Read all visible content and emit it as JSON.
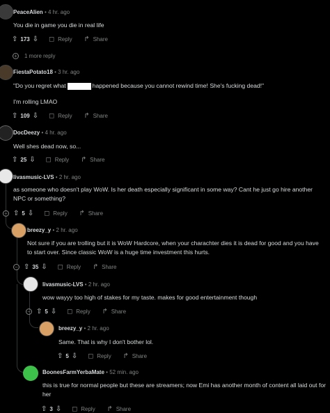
{
  "comments": [
    {
      "user": "PeaceAlien",
      "time": "4 hr. ago",
      "text": "You die in game you die in real life",
      "votes": "173",
      "reply": "Reply",
      "share": "Share",
      "more": "1 more reply"
    },
    {
      "user": "FiestaPotato18",
      "time": "3 hr. ago",
      "text_pre": "\"Do you regret what",
      "text_post": "happened because you cannot rewind time! She's fucking dead!\"",
      "text2": "I'm rolling LMAO",
      "votes": "109",
      "reply": "Reply",
      "share": "Share"
    },
    {
      "user": "DocDeezy",
      "time": "4 hr. ago",
      "text": "Well shes dead now, so...",
      "votes": "25",
      "reply": "Reply",
      "share": "Share"
    },
    {
      "user": "livasmusic-LVS",
      "time": "2 hr. ago",
      "text": "as someone who doesn't play WoW. Is her death especially significant in some way? Cant he just go hire another NPC or something?",
      "votes": "5",
      "reply": "Reply",
      "share": "Share"
    },
    {
      "user": "breezy_y",
      "time": "2 hr. ago",
      "text": "Not sure if you are trolling but it is WoW Hardcore, when your charachter dies it is dead for good and you have to start over. Since classic WoW is a huge time investment this hurts.",
      "votes": "35",
      "reply": "Reply",
      "share": "Share"
    },
    {
      "user": "livasmusic-LVS",
      "time": "2 hr. ago",
      "text": "wow wayyy too high of stakes for my taste. makes for good entertainment though",
      "votes": "5",
      "reply": "Reply",
      "share": "Share"
    },
    {
      "user": "breezy_y",
      "time": "2 hr. ago",
      "text": "Same. That is why I don't bother lol.",
      "votes": "5",
      "reply": "Reply",
      "share": "Share"
    },
    {
      "user": "BoonesFarmYerbaMate",
      "time": "52 min. ago",
      "text": "this is true for normal people but these are streamers; now Emi has another month of content all laid out for her",
      "votes": "3",
      "reply": "Reply",
      "share": "Share"
    }
  ],
  "icons": {
    "upvote": "arrow-up-icon",
    "downvote": "arrow-down-icon",
    "reply": "speech-bubble-icon",
    "share": "share-arrow-icon",
    "collapse": "minus-circle-icon",
    "expand": "plus-circle-icon"
  },
  "colors": {
    "background": "#000000",
    "text": "#d7dadc",
    "muted": "#818384",
    "line": "#343536"
  }
}
